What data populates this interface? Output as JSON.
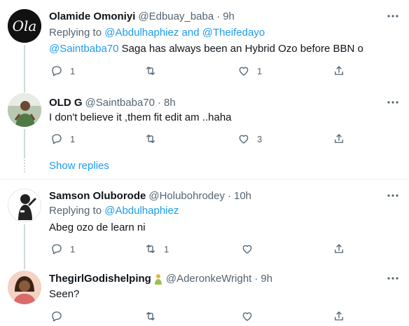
{
  "tweets": [
    {
      "name": "Olamide Omoniyi",
      "handle": "@Edbuay_baba",
      "time": "9h",
      "replying_prefix": "Replying to",
      "replying_to": "@Abdulhaphiez and @Theifedayo",
      "mention": "@Saintbaba70",
      "text": " Saga has always been an Hybrid Ozo before BBN o",
      "replies": "1",
      "retweets": "",
      "likes": "1",
      "avatar_text": "Ola"
    },
    {
      "name": "OLD G",
      "handle": "@Saintbaba70",
      "time": "8h",
      "text": "I don't believe it ,them fit edit am ..haha",
      "replies": "1",
      "retweets": "",
      "likes": "3"
    },
    {
      "name": "Samson Oluborode",
      "handle": "@Holubohrodey",
      "time": "10h",
      "replying_prefix": "Replying to",
      "replying_to": "@Abdulhaphiez",
      "text": "Abeg ozo de learn ni",
      "replies": "1",
      "retweets": "1",
      "likes": ""
    },
    {
      "name": "ThegirlGodishelping",
      "handle": "@AderonkeWright",
      "time": "9h",
      "text": "Seen?",
      "replies": "",
      "retweets": "",
      "likes": ""
    }
  ],
  "show_replies": "Show replies",
  "colors": {
    "accent": "#1d9bf0",
    "muted": "#536471",
    "text": "#0f1419",
    "line": "#cfd9de"
  },
  "icons": [
    "more-icon",
    "reply-icon",
    "retweet-icon",
    "like-icon",
    "share-icon"
  ]
}
